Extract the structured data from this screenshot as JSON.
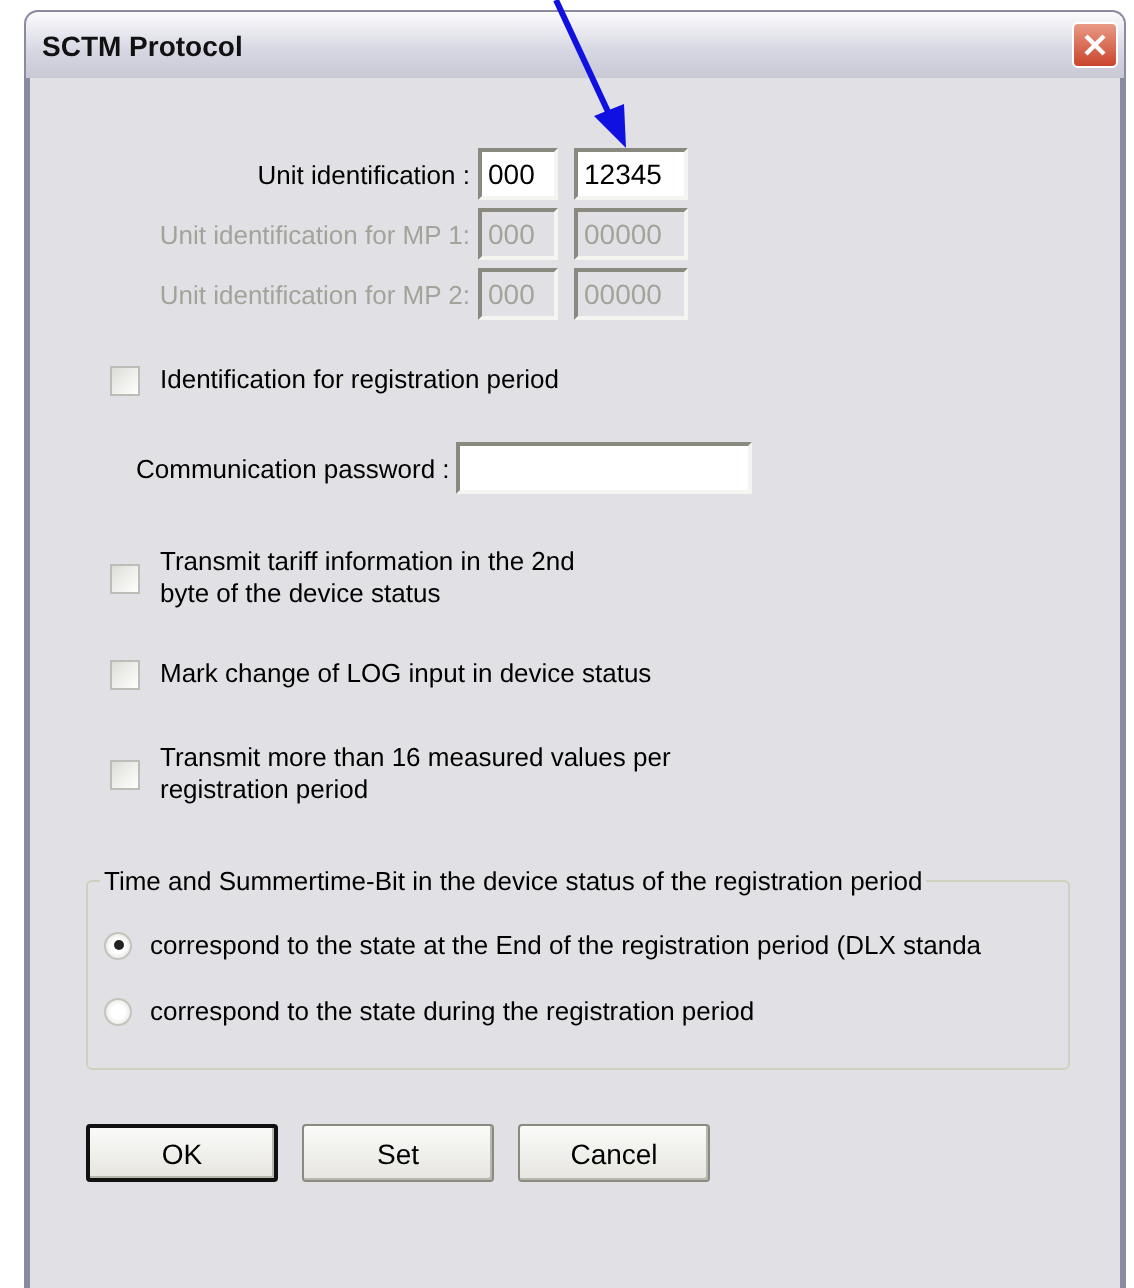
{
  "window": {
    "title": "SCTM Protocol"
  },
  "unit_ids": [
    {
      "label": "Unit identification :",
      "disabled": false,
      "fields": [
        "000",
        "12345"
      ]
    },
    {
      "label": "Unit identification for MP 1:",
      "disabled": true,
      "fields": [
        "000",
        "00000"
      ]
    },
    {
      "label": "Unit identification for MP 2:",
      "disabled": true,
      "fields": [
        "000",
        "00000"
      ]
    }
  ],
  "options": [
    {
      "kind": "checkbox",
      "label": "Identification for registration period",
      "checked": false
    },
    {
      "kind": "password",
      "label": "Communication password :"
    },
    {
      "kind": "checkbox",
      "label": "Transmit tariff information in the 2nd\nbyte of the device status",
      "checked": false
    },
    {
      "kind": "checkbox",
      "label": "Mark change of LOG input in device status",
      "checked": false
    },
    {
      "kind": "checkbox",
      "label": "Transmit more than 16 measured values per\nregistration period",
      "checked": false
    }
  ],
  "group": {
    "title": "Time and Summertime-Bit in the device status of the registration period",
    "radios": [
      {
        "label": "correspond to the state at the End of the registration period (DLX standa",
        "selected": true
      },
      {
        "label": "correspond to the state during the registration period",
        "selected": false
      }
    ]
  },
  "buttons": [
    {
      "label": "OK",
      "default": true
    },
    {
      "label": "Set",
      "default": false
    },
    {
      "label": "Cancel",
      "default": false
    }
  ]
}
